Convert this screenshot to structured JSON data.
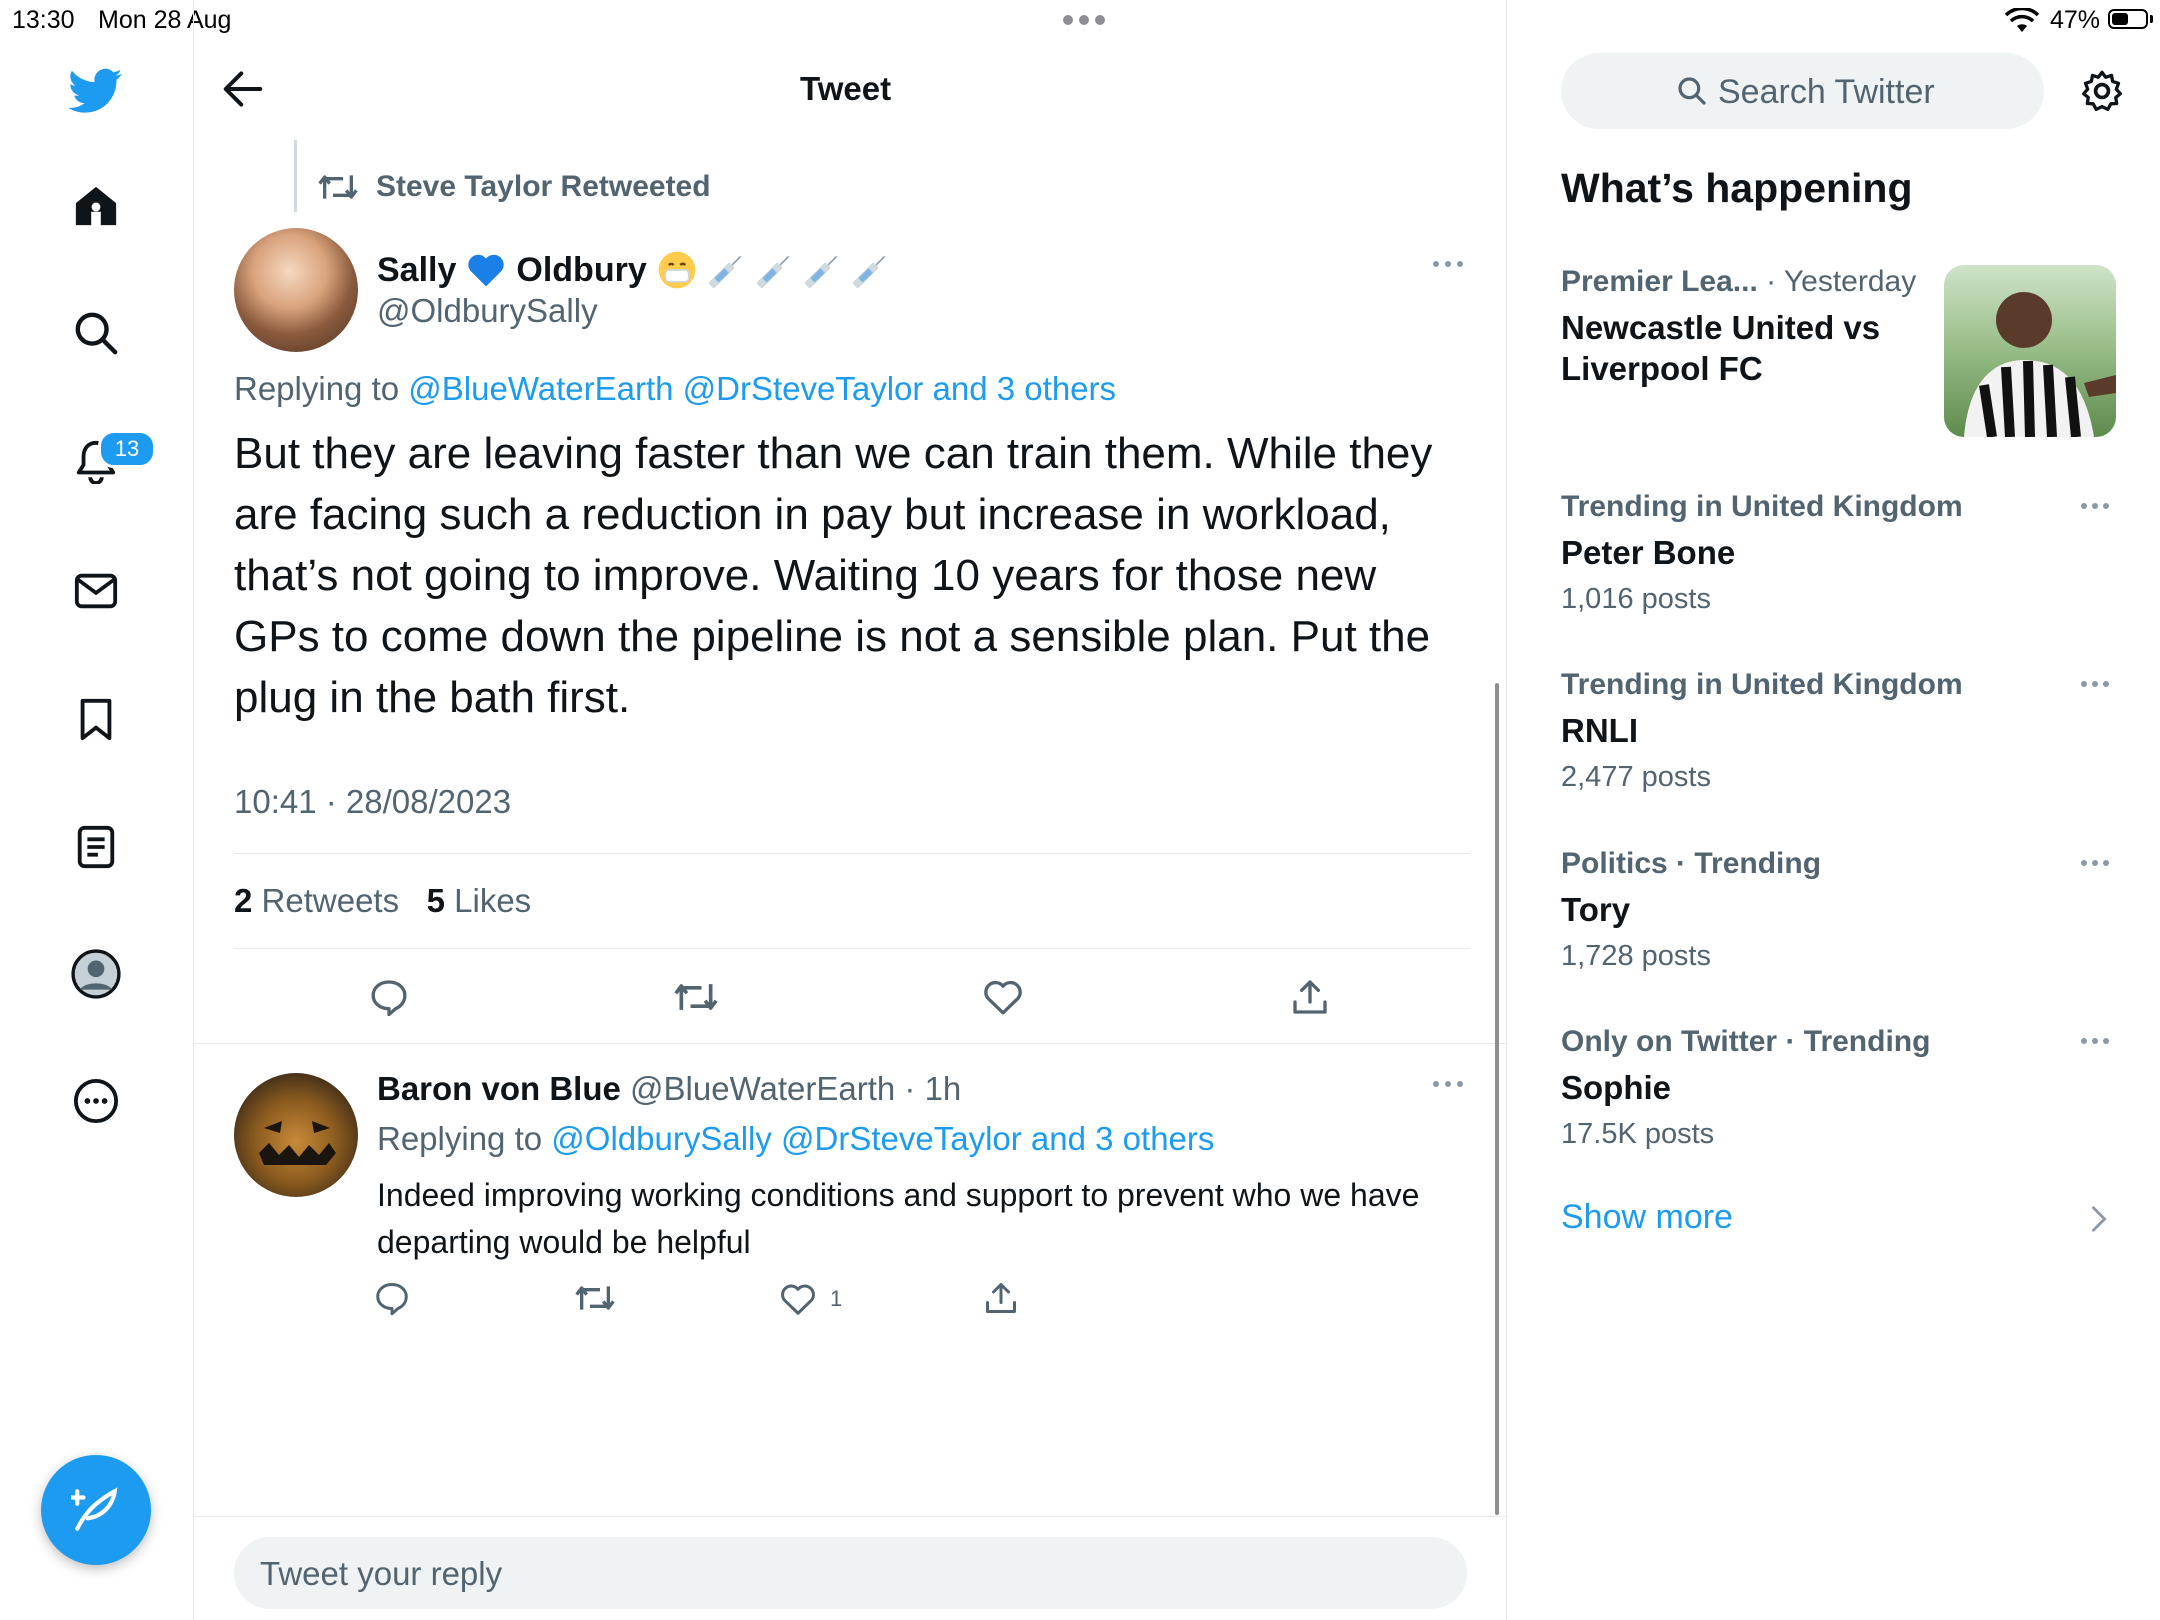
{
  "status_bar": {
    "time": "13:30",
    "date": "Mon 28 Aug",
    "battery": "47%"
  },
  "header": {
    "title": "Tweet"
  },
  "nav": {
    "notifications_badge": "13"
  },
  "tweet": {
    "retweeted_by": "Steve Taylor Retweeted",
    "name_first": "Sally",
    "name_last": "Oldbury",
    "handle": "@OldburySally",
    "replying_label": "Replying to",
    "replying_to": "@BlueWaterEarth @DrSteveTaylor and 3 others",
    "body": "But they are leaving faster than we can train them. While they are facing such a reduction in pay but increase in workload, that’s not going to improve. Waiting 10 years for those new GPs to come down the pipeline is not a sensible plan. Put the plug in the bath first.",
    "timestamp": "10:41 · 28/08/2023",
    "retweet_count": "2",
    "retweet_label": "Retweets",
    "like_count": "5",
    "like_label": "Likes"
  },
  "reply": {
    "name": "Baron von Blue",
    "handle_time": "@BlueWaterEarth · 1h",
    "replying_label": "Replying to",
    "replying_to": "@OldburySally @DrSteveTaylor and 3 others",
    "body": "Indeed improving working conditions and support to prevent who we have departing would be helpful",
    "like_count": "1"
  },
  "reply_box": {
    "placeholder": "Tweet your reply"
  },
  "sidebar": {
    "search_placeholder": "Search Twitter",
    "section_title": "What’s happening",
    "trends": [
      {
        "meta_cat": "Premier Lea...",
        "meta_rest": "· Yesterday",
        "title": "Newcastle United vs Liverpool FC",
        "count": ""
      },
      {
        "meta_cat": "Trending in United Kingdom",
        "meta_rest": "",
        "title": "Peter Bone",
        "count": "1,016 posts"
      },
      {
        "meta_cat": "Trending in United Kingdom",
        "meta_rest": "",
        "title": "RNLI",
        "count": "2,477 posts"
      },
      {
        "meta_cat": "Politics · Trending",
        "meta_rest": "",
        "title": "Tory",
        "count": "1,728 posts"
      },
      {
        "meta_cat": "Only on Twitter · Trending",
        "meta_rest": "",
        "title": "Sophie",
        "count": "17.5K posts"
      }
    ],
    "show_more": "Show more"
  },
  "colors": {
    "accent": "#1d9bf0",
    "text": "#0f1419",
    "muted": "#536471"
  }
}
